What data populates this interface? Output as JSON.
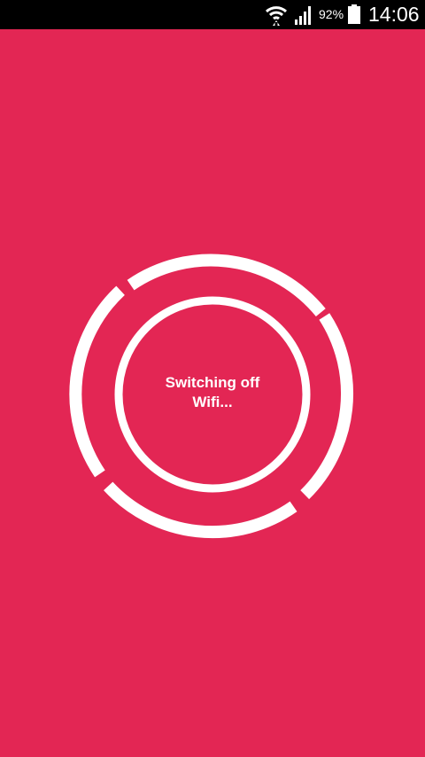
{
  "status_bar": {
    "battery_percent": "92%",
    "time": "14:06",
    "icons": [
      "wifi-icon",
      "signal-icon",
      "battery-icon"
    ]
  },
  "main": {
    "message_line1": "Switching off",
    "message_line2": "Wifi..."
  },
  "colors": {
    "background": "#e32654",
    "status_bar": "#000000",
    "foreground": "#ffffff"
  }
}
